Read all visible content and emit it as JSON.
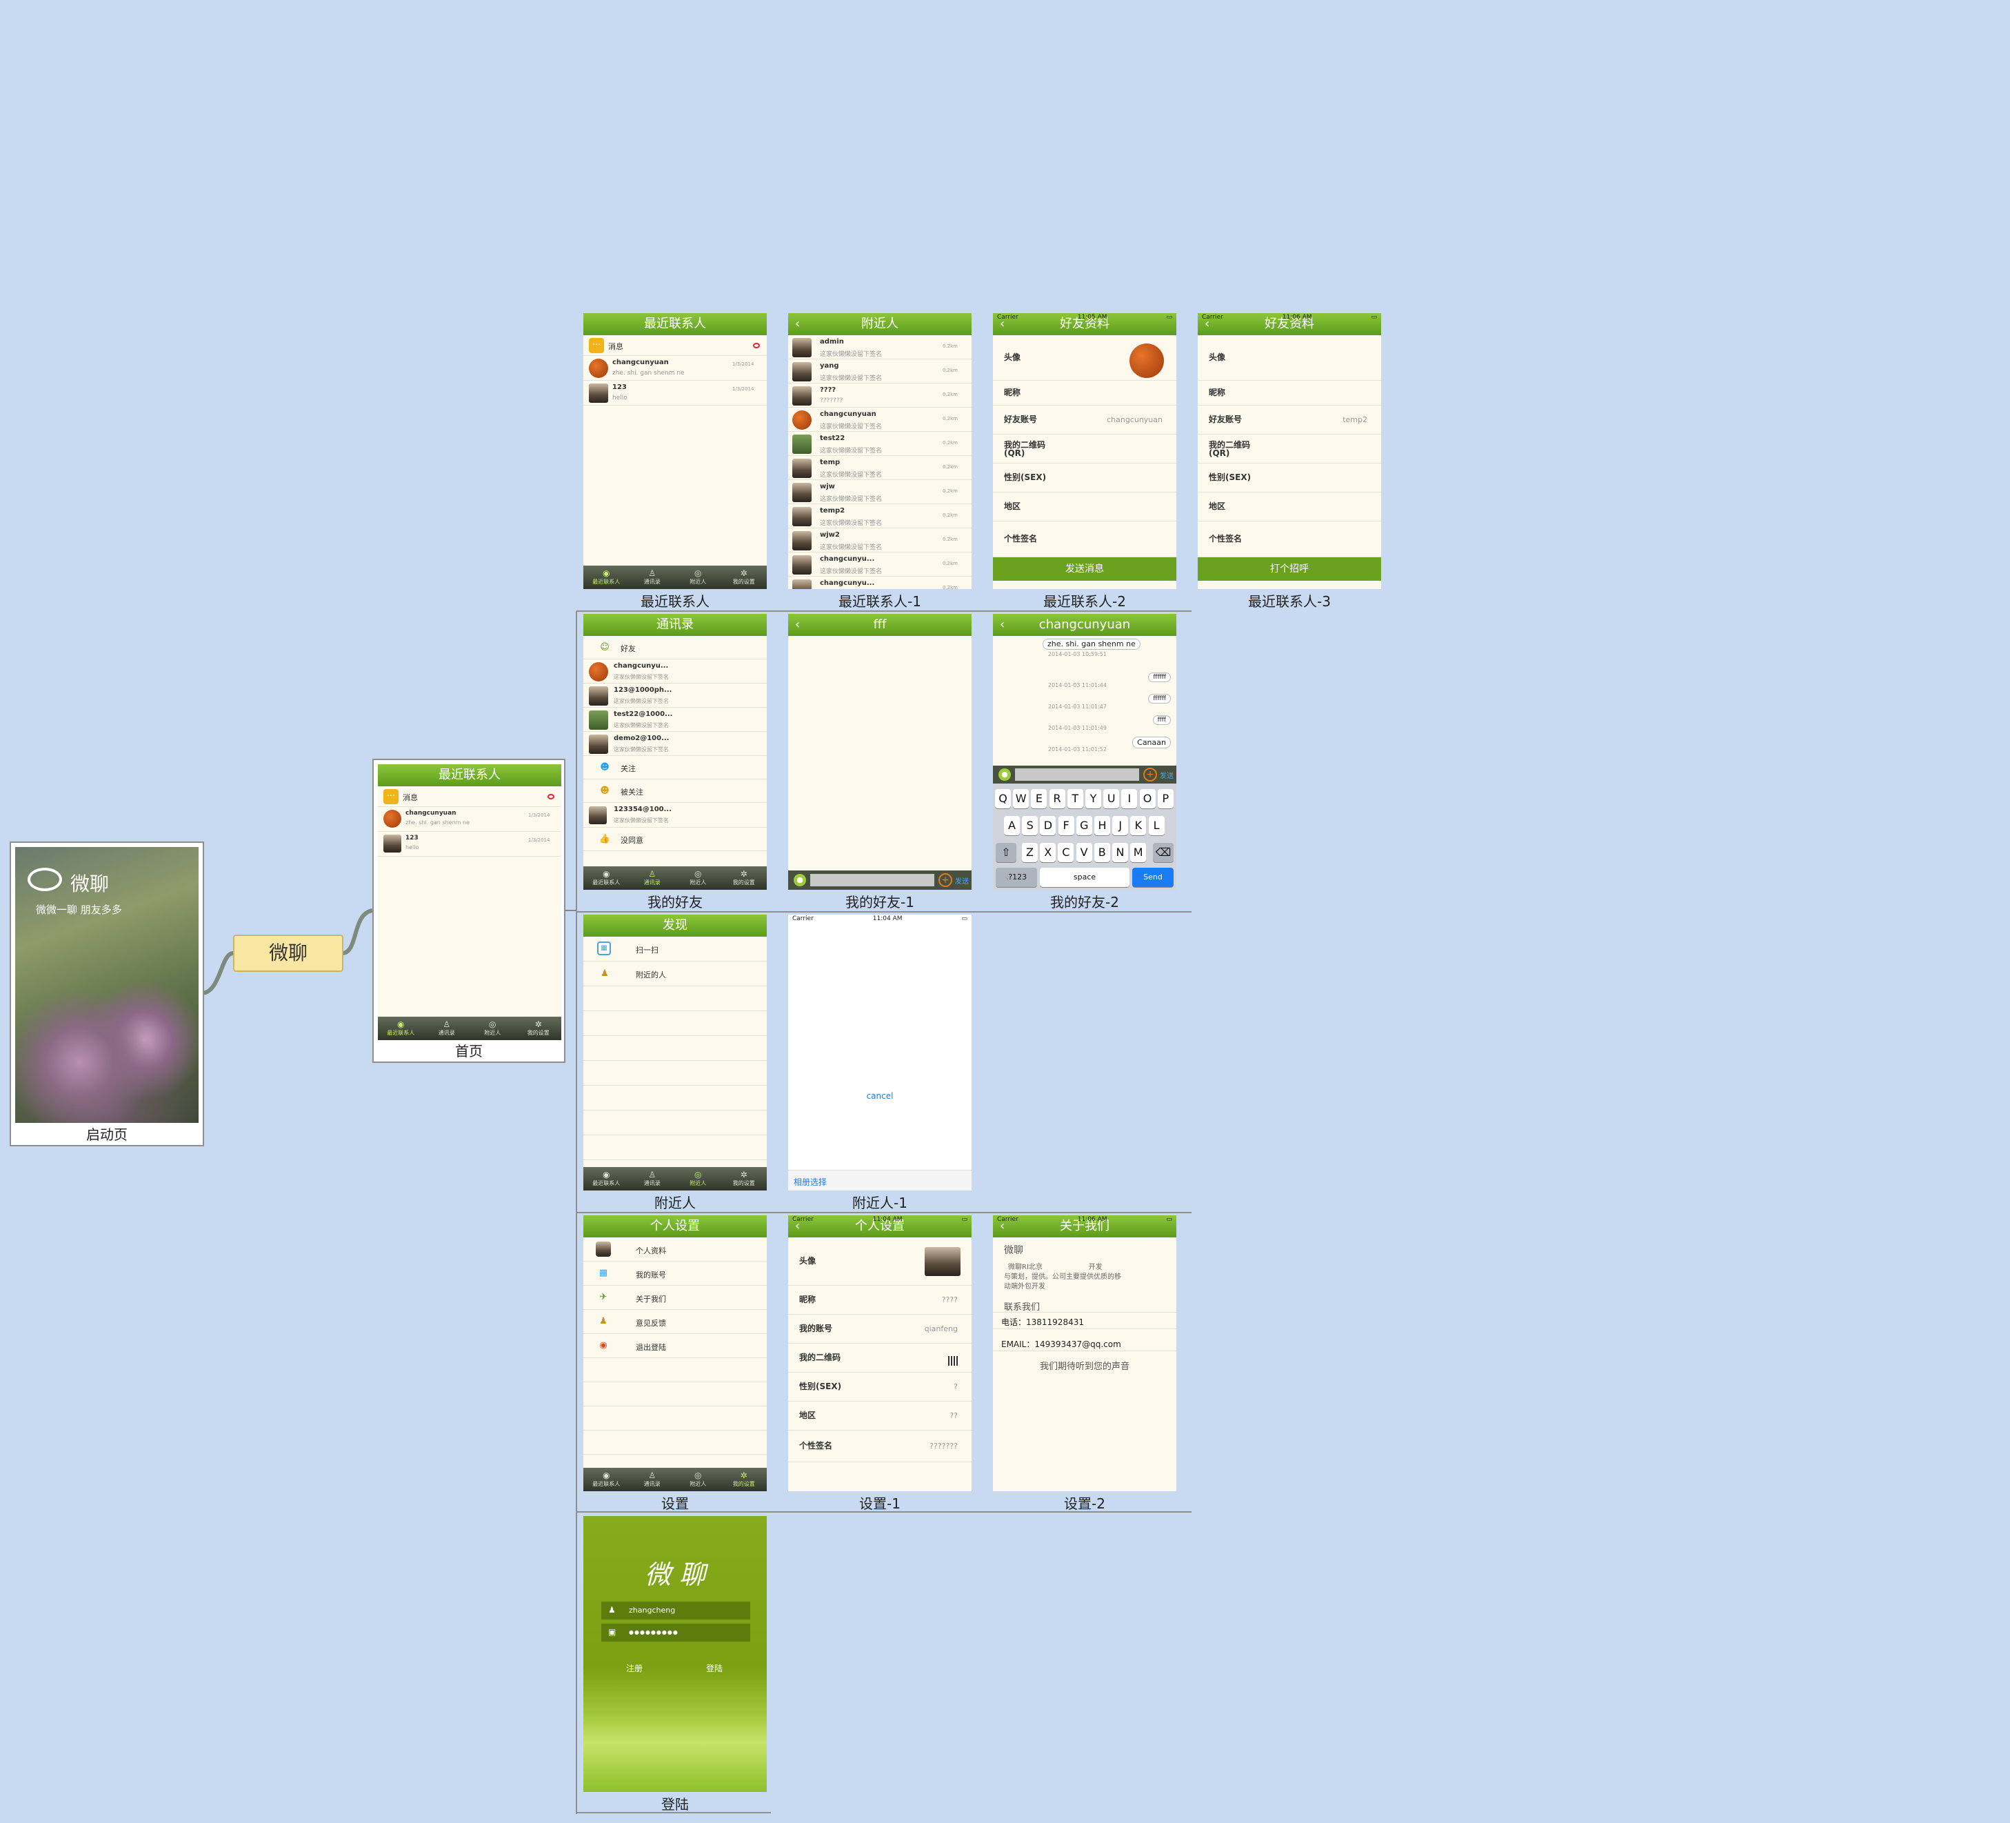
{
  "mindmap": {
    "root": "微聊",
    "captions": {
      "launch": "启动页",
      "home": "首页",
      "recent": "最近联系人",
      "recent1": "最近联系人-1",
      "recent2": "最近联系人-2",
      "recent3": "最近联系人-3",
      "friends": "我的好友",
      "friends1": "我的好友-1",
      "friends2": "我的好友-2",
      "nearby": "附近人",
      "nearby1": "附近人-1",
      "settings": "设置",
      "settings1": "设置-1",
      "settings2": "设置-2",
      "login": "登陆"
    }
  },
  "launch": {
    "logo_text": "微聊",
    "slogan": "微微一聊  朋友多多"
  },
  "tabs": [
    "最近联系人",
    "通讯录",
    "附近人",
    "我的设置"
  ],
  "recent": {
    "title": "最近联系人",
    "message_label": "消息",
    "items": [
      {
        "name": "changcunyuan",
        "sub": "zhe. shi. gan shenm ne",
        "time": "1/3/2014"
      },
      {
        "name": "123",
        "sub": "hello",
        "time": "1/3/2014"
      }
    ]
  },
  "nearby_list": {
    "title": "附近人",
    "distance": "0.2km",
    "signature": "这家伙懒懒没留下签名",
    "items": [
      {
        "name": "admin",
        "sub": "这家伙懒懒没留下签名"
      },
      {
        "name": "yang",
        "sub": "这家伙懒懒没留下签名"
      },
      {
        "name": "????",
        "sub": "???????"
      },
      {
        "name": "changcunyuan",
        "sub": "这家伙懒懒没留下签名"
      },
      {
        "name": "test22",
        "sub": "这家伙懒懒没留下签名"
      },
      {
        "name": "temp",
        "sub": "这家伙懒懒没留下签名"
      },
      {
        "name": "wjw",
        "sub": "这家伙懒懒没留下签名"
      },
      {
        "name": "temp2",
        "sub": "这家伙懒懒没留下签名"
      },
      {
        "name": "wjw2",
        "sub": "这家伙懒懒没留下签名"
      },
      {
        "name": "changcunyu...",
        "sub": "这家伙懒懒没留下签名"
      },
      {
        "name": "changcunyu...",
        "sub": ""
      }
    ]
  },
  "profile2": {
    "status_left": "Carrier",
    "time": "11:05 AM",
    "title": "好友资料",
    "rows": [
      {
        "label": "头像",
        "value": ""
      },
      {
        "label": "昵称",
        "value": ""
      },
      {
        "label": "好友账号",
        "value": "changcunyuan"
      },
      {
        "label": "我的二维码\n(QR)",
        "value": ""
      },
      {
        "label": "性别(SEX)",
        "value": ""
      },
      {
        "label": "地区",
        "value": ""
      },
      {
        "label": "个性签名",
        "value": ""
      }
    ],
    "button": "发送消息"
  },
  "profile3": {
    "status_left": "Carrier",
    "time": "11:06 AM",
    "title": "好友资料",
    "rows": [
      {
        "label": "头像",
        "value": ""
      },
      {
        "label": "昵称",
        "value": ""
      },
      {
        "label": "好友账号",
        "value": "temp2"
      },
      {
        "label": "我的二维码\n(QR)",
        "value": ""
      },
      {
        "label": "性别(SEX)",
        "value": ""
      },
      {
        "label": "地区",
        "value": ""
      },
      {
        "label": "个性签名",
        "value": ""
      }
    ],
    "button": "打个招呼"
  },
  "contacts": {
    "title": "通讯录",
    "friends_label": "好友",
    "items": [
      {
        "name": "changcunyu...",
        "sub": "这家伙懒懒没留下签名"
      },
      {
        "name": "123@1000ph...",
        "sub": "这家伙懒懒没留下签名"
      },
      {
        "name": "test22@1000...",
        "sub": "这家伙懒懒没留下签名"
      },
      {
        "name": "demo2@100...",
        "sub": "这家伙懒懒没留下签名"
      }
    ],
    "follow_label": "关注",
    "followed_label": "被关注",
    "extra": {
      "name": "123354@100...",
      "sub": "这家伙懒懒没留下签名"
    },
    "disagree_label": "没同意"
  },
  "chat_empty": {
    "title": "fff",
    "send": "发送"
  },
  "chat": {
    "title": "changcunyuan",
    "bubble_top": "zhe. shi. gan shenm ne",
    "messages": [
      {
        "time": "2014-01-03  10:59:51",
        "text": ""
      },
      {
        "time": "2014-01-03  11:01:44",
        "text": "ffffff"
      },
      {
        "time": "2014-01-03  11:01:47",
        "text": "ffffff"
      },
      {
        "time": "2014-01-03  11:01:49",
        "text": "ffff"
      },
      {
        "time": "2014-01-03  11:01:52",
        "text": "Canaan"
      }
    ],
    "send": "发送",
    "keyboard": {
      "row1": [
        "Q",
        "W",
        "E",
        "R",
        "T",
        "Y",
        "U",
        "I",
        "O",
        "P"
      ],
      "row2": [
        "A",
        "S",
        "D",
        "F",
        "G",
        "H",
        "J",
        "K",
        "L"
      ],
      "row3": [
        "Z",
        "X",
        "C",
        "V",
        "B",
        "N",
        "M"
      ],
      "mode": ".?123",
      "space": "space",
      "send": "Send"
    }
  },
  "discover": {
    "title": "发现",
    "items": [
      "扫一扫",
      "附近的人"
    ]
  },
  "scan": {
    "status_left": "Carrier",
    "time": "11:04 AM",
    "cancel": "cancel",
    "album": "相册选择"
  },
  "settings": {
    "title": "个人设置",
    "items": [
      "个人资料",
      "我的账号",
      "关于我们",
      "意见反馈",
      "退出登陆"
    ]
  },
  "settings1": {
    "status_left": "Carrier",
    "time": "11:04 AM",
    "title": "个人设置",
    "rows": [
      {
        "label": "头像",
        "value": ""
      },
      {
        "label": "昵称",
        "value": "????"
      },
      {
        "label": "我的账号",
        "value": "qianfeng"
      },
      {
        "label": "我的二维码",
        "value": ""
      },
      {
        "label": "性别(SEX)",
        "value": "?"
      },
      {
        "label": "地区",
        "value": "??"
      },
      {
        "label": "个性签名",
        "value": "???????"
      }
    ]
  },
  "about": {
    "status_left": "Carrier",
    "time": "11:06 AM",
    "title": "关于我们",
    "app_name": "微聊",
    "desc1": "微聊RI北京                     开发",
    "desc2": "与策划，提供。公司主要提供优质的移",
    "desc3": "动端外包开发",
    "contact_label": "联系我们",
    "phone": "电话：13811928431",
    "email": "EMAIL：149393437@qq.com",
    "slogan": "我们期待听到您的声音"
  },
  "login": {
    "logo": "微 聊",
    "username": "zhangcheng",
    "password": "●●●●●●●●●",
    "register": "注册",
    "login": "登陆"
  },
  "colors": {
    "background": "#c7daf1",
    "header_green": "#6aa21f",
    "content_cream": "#fdf9ec",
    "tabbar": "#3a4233",
    "root_node": "#f7e7a0"
  }
}
